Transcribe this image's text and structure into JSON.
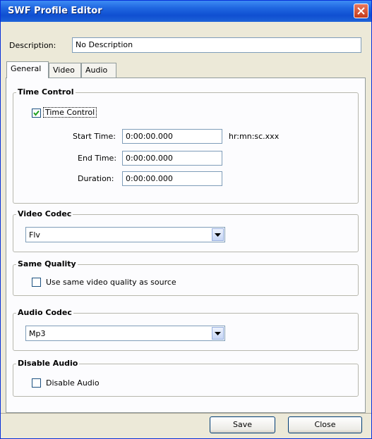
{
  "window": {
    "title": "SWF Profile Editor"
  },
  "description": {
    "label": "Description:",
    "value": "No Description"
  },
  "tabs": [
    {
      "label": "General"
    },
    {
      "label": "Video"
    },
    {
      "label": "Audio"
    }
  ],
  "time_control": {
    "group_title": "Time Control",
    "checkbox_label": "Time Control",
    "checked": true,
    "start_label": "Start Time:",
    "start_value": "0:00:00.000",
    "format_hint": "hr:mn:sc.xxx",
    "end_label": "End Time:",
    "end_value": "0:00:00.000",
    "duration_label": "Duration:",
    "duration_value": "0:00:00.000"
  },
  "video_codec": {
    "group_title": "Video Codec",
    "selected": "Flv"
  },
  "same_quality": {
    "group_title": "Same Quality",
    "checkbox_label": "Use same video quality as source",
    "checked": false
  },
  "audio_codec": {
    "group_title": "Audio Codec",
    "selected": "Mp3"
  },
  "disable_audio": {
    "group_title": "Disable Audio",
    "checkbox_label": "Disable Audio",
    "checked": false
  },
  "buttons": {
    "save": "Save",
    "close": "Close"
  },
  "icons": {
    "close": "close-icon",
    "check": "check-mark-icon",
    "dropdown": "chevron-down-icon"
  }
}
